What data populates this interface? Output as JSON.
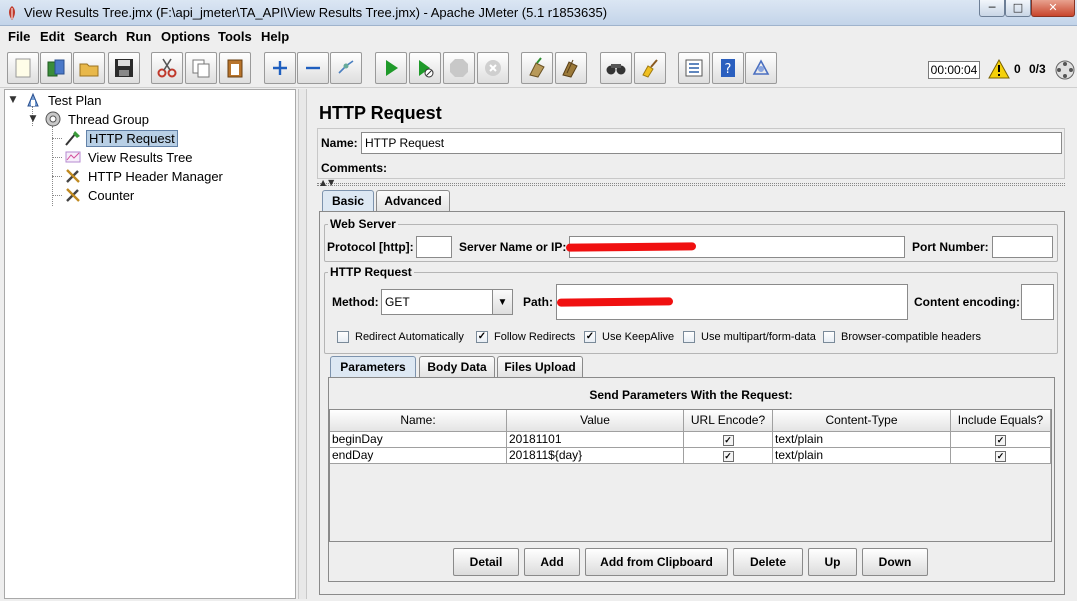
{
  "window": {
    "title": "View Results Tree.jmx (F:\\api_jmeter\\TA_API\\View Results Tree.jmx) - Apache JMeter (5.1 r1853635)"
  },
  "menu": [
    "File",
    "Edit",
    "Search",
    "Run",
    "Options",
    "Tools",
    "Help"
  ],
  "toolbar": {
    "icons": [
      "new-icon",
      "templates-icon",
      "open-icon",
      "save-icon",
      "cut-icon",
      "copy-icon",
      "paste-icon",
      "expand-icon",
      "collapse-icon",
      "toggle-icon",
      "start-icon",
      "start-no-pause-icon",
      "stop-icon",
      "shutdown-icon",
      "clear-icon",
      "clear-all-icon",
      "search-icon",
      "reset-search-icon",
      "function-helper-icon",
      "help-icon",
      "remote-icon"
    ],
    "elapsed_time": "00:00:04",
    "error_count": "0",
    "thread_count": "0/3"
  },
  "tree": {
    "nodes": [
      {
        "label": "Test Plan",
        "icon": "test-plan-icon"
      },
      {
        "label": "Thread Group",
        "icon": "thread-group-icon"
      },
      {
        "label": "HTTP Request",
        "icon": "sampler-icon",
        "selected": true
      },
      {
        "label": "View Results Tree",
        "icon": "listener-icon"
      },
      {
        "label": "HTTP Header Manager",
        "icon": "config-tool-icon"
      },
      {
        "label": "Counter",
        "icon": "config-tool-icon"
      }
    ]
  },
  "editor": {
    "title": "HTTP Request",
    "name_label": "Name:",
    "name_value": "HTTP Request",
    "comments_label": "Comments:",
    "tabs": [
      "Basic",
      "Advanced"
    ],
    "web_server": {
      "title": "Web Server",
      "protocol_label": "Protocol [http]:",
      "protocol_value": "",
      "server_label": "Server Name or IP:",
      "port_label": "Port Number:",
      "port_value": ""
    },
    "http_request": {
      "title": "HTTP Request",
      "method_label": "Method:",
      "method_value": "GET",
      "path_label": "Path:",
      "encoding_label": "Content encoding:",
      "encoding_value": ""
    },
    "options": [
      {
        "label": "Redirect Automatically",
        "checked": false
      },
      {
        "label": "Follow Redirects",
        "checked": true
      },
      {
        "label": "Use KeepAlive",
        "checked": true
      },
      {
        "label": "Use multipart/form-data",
        "checked": false
      },
      {
        "label": "Browser-compatible headers",
        "checked": false
      }
    ],
    "sub_tabs": [
      "Parameters",
      "Body Data",
      "Files Upload"
    ],
    "params_caption": "Send Parameters With the Request:",
    "table": {
      "headers": [
        "Name:",
        "Value",
        "URL Encode?",
        "Content-Type",
        "Include Equals?"
      ],
      "rows": [
        {
          "name": "beginDay",
          "value": "20181101",
          "url_encode": true,
          "content_type": "text/plain",
          "include_equals": true
        },
        {
          "name": "endDay",
          "value": "201811${day}",
          "url_encode": true,
          "content_type": "text/plain",
          "include_equals": true
        }
      ]
    },
    "buttons": [
      "Detail",
      "Add",
      "Add from Clipboard",
      "Delete",
      "Up",
      "Down"
    ]
  },
  "colors": {
    "selection": "#b8cfe5",
    "redaction": "#f01010"
  }
}
